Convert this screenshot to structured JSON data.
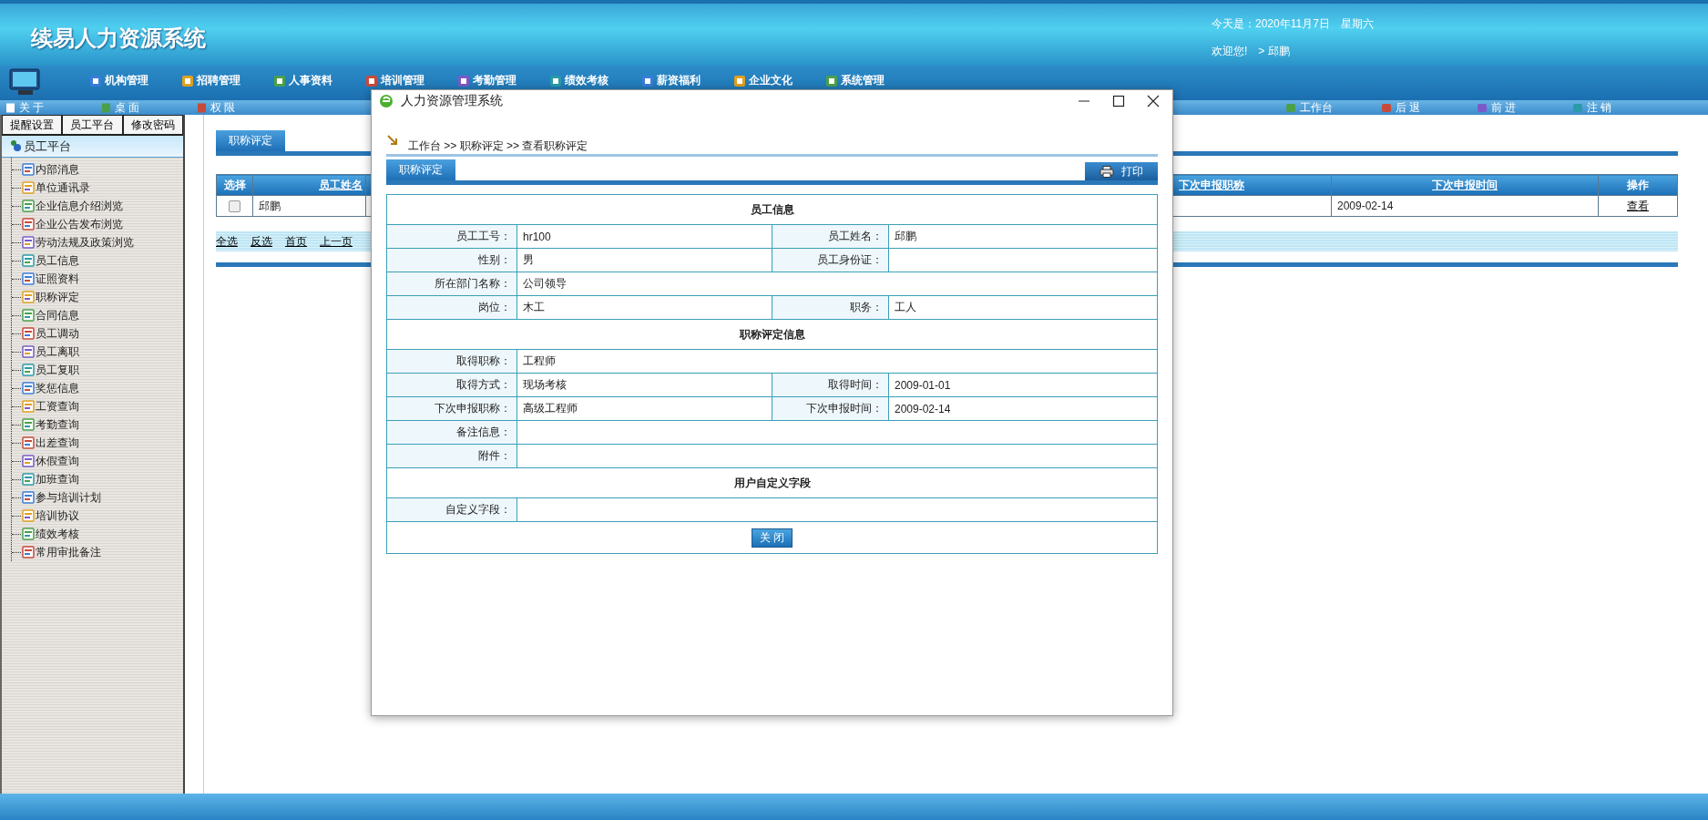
{
  "header": {
    "title": "续易人力资源系统",
    "date_text": "今天是：2020年11月7日　星期六",
    "welcome": "欢迎您!　> 邱鹏"
  },
  "nav_menu": [
    {
      "label": "机构管理"
    },
    {
      "label": "招聘管理"
    },
    {
      "label": "人事资料"
    },
    {
      "label": "培训管理"
    },
    {
      "label": "考勤管理"
    },
    {
      "label": "绩效考核"
    },
    {
      "label": "薪资福利"
    },
    {
      "label": "企业文化"
    },
    {
      "label": "系统管理"
    }
  ],
  "toolbar_left": [
    "关 于",
    "桌 面",
    "权 限"
  ],
  "toolbar_right": [
    "工作台",
    "后 退",
    "前 进",
    "注 销"
  ],
  "sidebar": {
    "tabs": [
      "提醒设置",
      "员工平台",
      "修改密码"
    ],
    "section_title": "员工平台",
    "items": [
      "内部消息",
      "单位通讯录",
      "企业信息介绍浏览",
      "企业公告发布浏览",
      "劳动法规及政策浏览",
      "员工信息",
      "证照资料",
      "职称评定",
      "合同信息",
      "员工调动",
      "员工离职",
      "员工复职",
      "奖惩信息",
      "工资查询",
      "考勤查询",
      "出差查询",
      "休假查询",
      "加班查询",
      "参与培训计划",
      "培训协议",
      "绩效考核",
      "常用审批备注"
    ]
  },
  "main": {
    "tab": "职称评定",
    "table": {
      "columns": [
        {
          "label": "选择",
          "sortable": false
        },
        {
          "label": "员工姓名",
          "sortable": true
        },
        {
          "label": "下次申报职称",
          "sortable": true
        },
        {
          "label": "下次申报时间",
          "sortable": true
        },
        {
          "label": "操作",
          "sortable": false
        }
      ],
      "rows": [
        {
          "checked": false,
          "name": "邱鹏",
          "next_date": "2009-02-14",
          "action": "查看"
        }
      ]
    },
    "pager": [
      "全选",
      "反选",
      "首页",
      "上一页"
    ]
  },
  "dialog": {
    "title": "人力资源管理系统",
    "breadcrumb": "工作台 >> 职称评定 >> 查看职称评定",
    "tab": "职称评定",
    "print_button": "打印",
    "sections": [
      {
        "heading": "员工信息",
        "rows": [
          [
            {
              "label": "员工工号：",
              "value": "hr100"
            },
            {
              "label": "员工姓名：",
              "value": "邱鹏"
            }
          ],
          [
            {
              "label": "性别：",
              "value": "男"
            },
            {
              "label": "员工身份证："
            }
          ],
          [
            {
              "label": "所在部门名称：",
              "value": "公司领导"
            }
          ],
          [
            {
              "label": "岗位：",
              "value": "木工"
            },
            {
              "label": "职务：",
              "value": "工人"
            }
          ]
        ]
      },
      {
        "heading": "职称评定信息",
        "rows": [
          [
            {
              "label": "取得职称：",
              "value": "工程师"
            }
          ],
          [
            {
              "label": "取得方式：",
              "value": "现场考核"
            },
            {
              "label": "取得时间：",
              "value": "2009-01-01"
            }
          ],
          [
            {
              "label": "下次申报职称：",
              "value": "高级工程师"
            },
            {
              "label": "下次申报时间：",
              "value": "2009-02-14"
            }
          ],
          [
            {
              "label": "备注信息："
            }
          ],
          [
            {
              "label": "附件："
            }
          ]
        ]
      },
      {
        "heading": "用户自定义字段",
        "rows": [
          [
            {
              "label": "自定义字段："
            }
          ]
        ]
      }
    ],
    "close_button": "关 闭"
  }
}
